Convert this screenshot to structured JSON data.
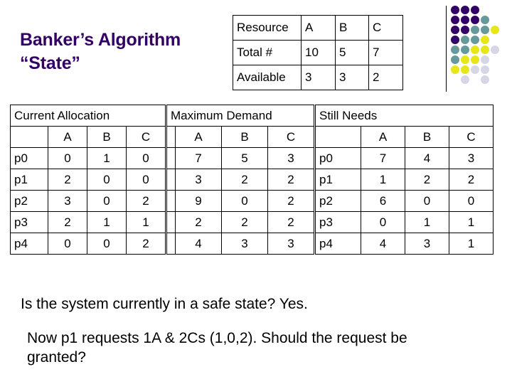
{
  "title": {
    "line1": "Banker’s Algorithm",
    "line2": "“State”",
    "color": "#330066"
  },
  "decoration": {
    "name": "dot-grid",
    "colors": {
      "purple": "#330066",
      "teal": "#669999",
      "yellow": "#E6E619",
      "lavender": "#D6D6E6"
    },
    "rows": [
      [
        "purple",
        "purple",
        "purple",
        "",
        ""
      ],
      [
        "purple",
        "purple",
        "purple",
        "teal",
        ""
      ],
      [
        "purple",
        "purple",
        "teal",
        "teal",
        "yellow"
      ],
      [
        "purple",
        "teal",
        "teal",
        "yellow",
        ""
      ],
      [
        "teal",
        "teal",
        "yellow",
        "yellow",
        "lavender"
      ],
      [
        "teal",
        "yellow",
        "yellow",
        "lavender",
        ""
      ],
      [
        "yellow",
        "yellow",
        "lavender",
        "lavender",
        ""
      ],
      [
        "",
        "lavender",
        "",
        "lavender",
        ""
      ]
    ]
  },
  "resource_table": {
    "name": "resource-summary",
    "rows": [
      [
        "Resource",
        "A",
        "B",
        "C"
      ],
      [
        "Total #",
        "10",
        "5",
        "7"
      ],
      [
        "Available",
        "3",
        "3",
        "2"
      ]
    ]
  },
  "allocation_table": {
    "caption": "Current Allocation",
    "columns": [
      "",
      "A",
      "B",
      "C"
    ],
    "rows": [
      [
        "p0",
        "0",
        "1",
        "0"
      ],
      [
        "p1",
        "2",
        "0",
        "0"
      ],
      [
        "p2",
        "3",
        "0",
        "2"
      ],
      [
        "p3",
        "2",
        "1",
        "1"
      ],
      [
        "p4",
        "0",
        "0",
        "2"
      ]
    ]
  },
  "demand_table": {
    "caption": "Maximum Demand",
    "columns": [
      "",
      "A",
      "B",
      "C"
    ],
    "rows": [
      [
        "",
        "7",
        "5",
        "3"
      ],
      [
        "",
        "3",
        "2",
        "2"
      ],
      [
        "",
        "9",
        "0",
        "2"
      ],
      [
        "",
        "2",
        "2",
        "2"
      ],
      [
        "",
        "4",
        "3",
        "3"
      ]
    ]
  },
  "needs_table": {
    "caption": "Still Needs",
    "columns": [
      "",
      "A",
      "B",
      "C"
    ],
    "rows": [
      [
        "p0",
        "7",
        "4",
        "3"
      ],
      [
        "p1",
        "1",
        "2",
        "2"
      ],
      [
        "p2",
        "6",
        "0",
        "0"
      ],
      [
        "p3",
        "0",
        "1",
        "1"
      ],
      [
        "p4",
        "4",
        "3",
        "1"
      ]
    ]
  },
  "body": {
    "question_safe_state": "Is the system currently in a safe state? Yes.",
    "question_request": "Now p1 requests 1A & 2Cs (1,0,2).  Should the request be granted?"
  }
}
